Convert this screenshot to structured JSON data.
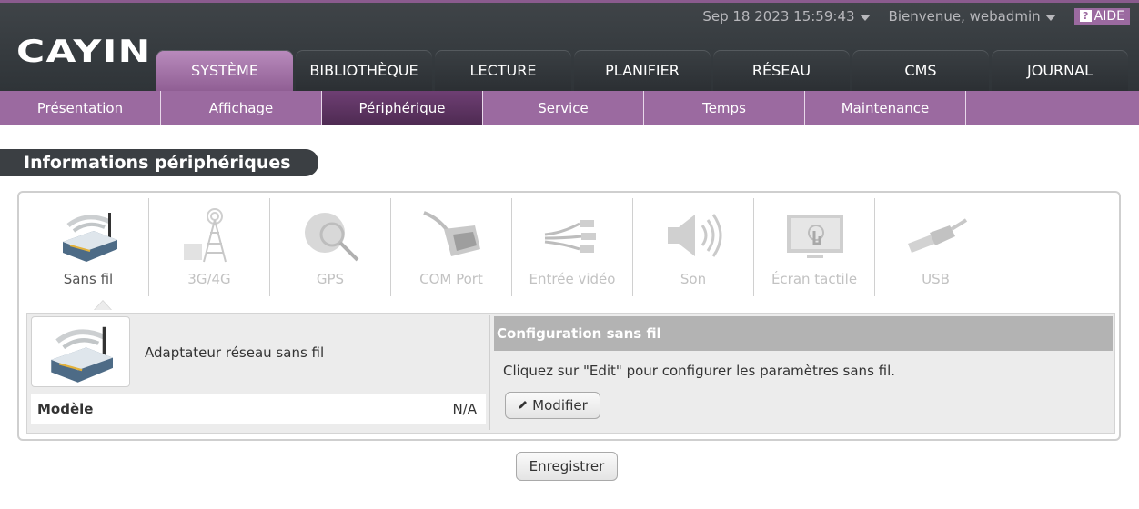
{
  "header": {
    "logo": "CAYIN",
    "datetime": "Sep 18 2023 15:59:43",
    "welcome": "Bienvenue, webadmin",
    "help_label": "AIDE",
    "help_icon_glyph": "?",
    "tabs": [
      {
        "label": "SYSTÈME",
        "active": true
      },
      {
        "label": "BIBLIOTHÈQUE"
      },
      {
        "label": "LECTURE"
      },
      {
        "label": "PLANIFIER"
      },
      {
        "label": "RÉSEAU"
      },
      {
        "label": "CMS"
      },
      {
        "label": "JOURNAL"
      }
    ]
  },
  "subnav": {
    "items": [
      {
        "label": "Présentation"
      },
      {
        "label": "Affichage"
      },
      {
        "label": "Périphérique",
        "active": true
      },
      {
        "label": "Service"
      },
      {
        "label": "Temps"
      },
      {
        "label": "Maintenance"
      }
    ]
  },
  "section_title": "Informations périphériques",
  "devices": [
    {
      "label": "Sans fil",
      "icon": "wireless-router-icon",
      "active": true
    },
    {
      "label": "3G/4G",
      "icon": "cell-tower-icon"
    },
    {
      "label": "GPS",
      "icon": "gps-globe-icon"
    },
    {
      "label": "COM Port",
      "icon": "serial-cable-icon"
    },
    {
      "label": "Entrée vidéo",
      "icon": "av-cable-icon"
    },
    {
      "label": "Son",
      "icon": "speaker-icon"
    },
    {
      "label": "Écran tactile",
      "icon": "touchscreen-icon"
    },
    {
      "label": "USB",
      "icon": "usb-cable-icon"
    }
  ],
  "detail": {
    "adapter_title": "Adaptateur réseau sans fil",
    "model_label": "Modèle",
    "model_value": "N/A",
    "config_title": "Configuration sans fil",
    "config_text": "Cliquez sur \"Edit\" pour configurer les paramètres sans fil.",
    "modify_label": "Modifier"
  },
  "save_label": "Enregistrer",
  "colors": {
    "accent": "#9b6aa0",
    "accent_dark": "#5a2f5e",
    "header_bg": "#363b3f"
  }
}
